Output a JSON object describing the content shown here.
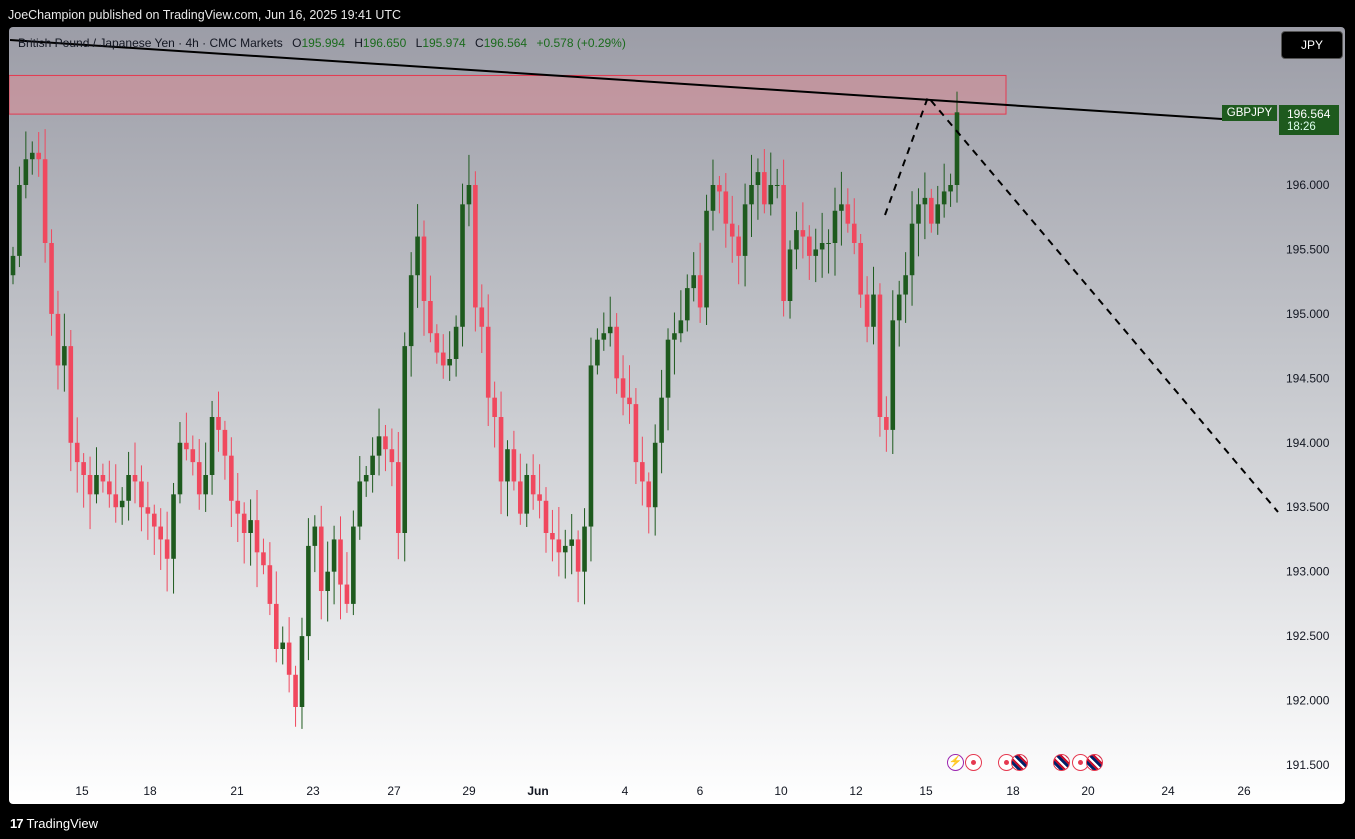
{
  "header": {
    "publish_line": "JoeChampion published on TradingView.com, Jun 16, 2025 19:41 UTC"
  },
  "legend": {
    "instrument": "British Pound / Japanese Yen · 4h · CMC Markets",
    "o_label": "O",
    "o_value": "195.994",
    "h_label": "H",
    "h_value": "196.650",
    "l_label": "L",
    "l_value": "195.974",
    "c_label": "C",
    "c_value": "196.564",
    "change": "+0.578 (+0.29%)"
  },
  "toolbar": {
    "currency_button": "JPY"
  },
  "price_scale": {
    "symbol_tag": "GBPJPY",
    "last_price": "196.564",
    "countdown": "18:26",
    "ticks": [
      "196.000",
      "195.500",
      "195.000",
      "194.500",
      "194.000",
      "193.500",
      "193.000",
      "192.500",
      "192.000",
      "191.500"
    ]
  },
  "time_axis": {
    "labels": [
      "15",
      "18",
      "21",
      "23",
      "27",
      "29",
      "Jun",
      "4",
      "6",
      "10",
      "12",
      "15",
      "18",
      "20",
      "24",
      "26"
    ]
  },
  "footer": {
    "brand": "TradingView",
    "brand_mark": "17"
  },
  "colors": {
    "up": "#1e5a1e",
    "down": "#f0485e",
    "zone": "#d98a93",
    "trendline": "#000000",
    "tag": "#1e5a1e"
  },
  "events": [
    {
      "icon": "bolt-icon"
    },
    {
      "icon": "red-dot-icon"
    },
    {
      "icon": "red-dot-icon"
    },
    {
      "icon": "uk-flag-icon"
    },
    {
      "icon": "uk-flag-icon"
    },
    {
      "icon": "red-dot-icon"
    },
    {
      "icon": "uk-flag-icon"
    }
  ],
  "chart_data": {
    "type": "candlestick",
    "title": "British Pound / Japanese Yen · 4h · CMC Markets",
    "xlabel": "",
    "ylabel": "",
    "ylim": [
      191.4,
      197.3
    ],
    "grid": false,
    "x_labels": [
      "15",
      "18",
      "21",
      "23",
      "27",
      "29",
      "Jun",
      "4",
      "6",
      "10",
      "12",
      "15",
      "18",
      "20",
      "24",
      "26"
    ],
    "closes": [
      195.45,
      196.0,
      196.2,
      196.25,
      196.2,
      195.55,
      195.0,
      194.6,
      194.75,
      194.0,
      193.85,
      193.75,
      193.6,
      193.75,
      193.7,
      193.6,
      193.5,
      193.55,
      193.75,
      193.7,
      193.5,
      193.45,
      193.35,
      193.25,
      193.1,
      193.6,
      194.0,
      193.95,
      193.85,
      193.6,
      193.75,
      194.2,
      194.1,
      193.9,
      193.55,
      193.45,
      193.3,
      193.4,
      193.15,
      193.05,
      192.75,
      192.4,
      192.45,
      192.2,
      191.95,
      192.5,
      193.2,
      193.35,
      192.85,
      193.0,
      193.25,
      192.9,
      192.75,
      193.35,
      193.7,
      193.75,
      193.9,
      194.05,
      193.95,
      193.85,
      193.3,
      194.75,
      195.3,
      195.6,
      195.1,
      194.85,
      194.7,
      194.6,
      194.65,
      194.9,
      195.85,
      196.0,
      195.05,
      194.9,
      194.35,
      194.2,
      193.7,
      193.95,
      193.7,
      193.45,
      193.75,
      193.6,
      193.55,
      193.3,
      193.25,
      193.15,
      193.2,
      193.25,
      193.0,
      193.35,
      194.6,
      194.8,
      194.85,
      194.9,
      194.5,
      194.35,
      194.3,
      193.85,
      193.7,
      193.5,
      194.0,
      194.35,
      194.8,
      194.85,
      194.95,
      195.2,
      195.3,
      195.05,
      195.8,
      196.0,
      195.95,
      195.7,
      195.6,
      195.45,
      195.85,
      196.0,
      196.1,
      195.85,
      196.0,
      196.0,
      195.1,
      195.5,
      195.65,
      195.6,
      195.45,
      195.5,
      195.55,
      195.55,
      195.8,
      195.85,
      195.7,
      195.55,
      195.15,
      194.9,
      195.15,
      194.2,
      194.1,
      194.95,
      195.15,
      195.3,
      195.7,
      195.85,
      195.9,
      195.7,
      195.85,
      195.95,
      196.0,
      196.564
    ],
    "annotations": [
      {
        "kind": "resistance-zone",
        "price_from": 196.55,
        "price_to": 196.85
      },
      {
        "kind": "trendline",
        "from": {
          "x": "start",
          "y": 196.85
        },
        "to": {
          "x": "Jun 16",
          "y": 196.6
        }
      },
      {
        "kind": "projection-dashed",
        "points": [
          {
            "x": "Jun 14",
            "y": 195.8
          },
          {
            "x": "Jun 15",
            "y": 196.65
          },
          {
            "x": "Jun 26",
            "y": 193.45
          }
        ]
      }
    ]
  }
}
